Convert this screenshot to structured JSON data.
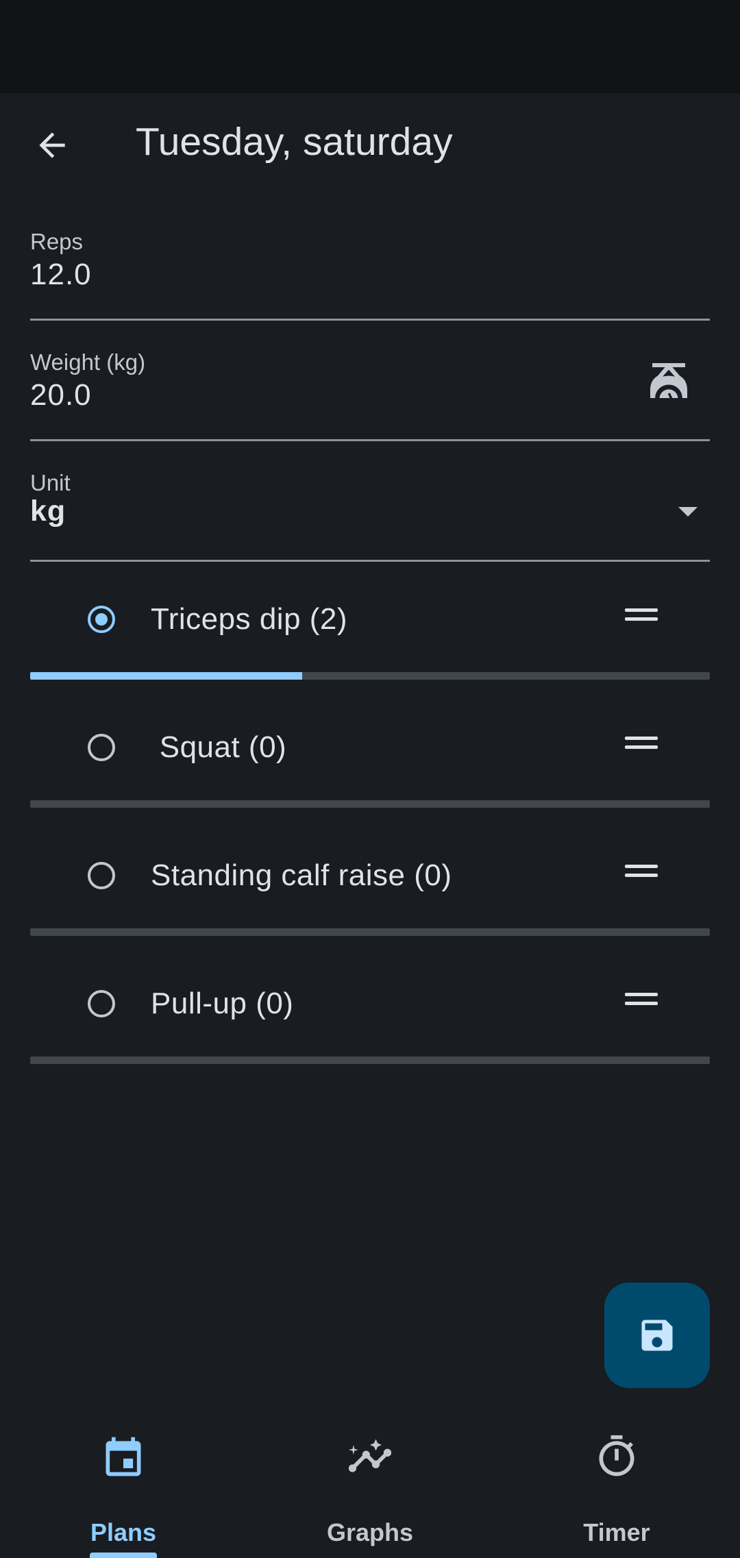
{
  "app_bar": {
    "title": "Tuesday, saturday"
  },
  "fields": {
    "reps": {
      "label": "Reps",
      "value": "12.0"
    },
    "weight": {
      "label": "Weight (kg)",
      "value": "20.0"
    },
    "unit": {
      "label": "Unit",
      "value": "kg"
    }
  },
  "exercises": [
    {
      "name": "Triceps dip (2)",
      "selected": true,
      "progress": 0.4
    },
    {
      "name": " Squat (0)",
      "selected": false,
      "progress": 0
    },
    {
      "name": "Standing calf raise (0)",
      "selected": false,
      "progress": 0
    },
    {
      "name": "Pull-up (0)",
      "selected": false,
      "progress": 0
    }
  ],
  "nav": {
    "items": [
      {
        "label": "Plans",
        "icon": "calendar-icon",
        "active": true
      },
      {
        "label": "Graphs",
        "icon": "insights-icon",
        "active": false
      },
      {
        "label": "Timer",
        "icon": "stopwatch-icon",
        "active": false
      }
    ]
  },
  "colors": {
    "accent": "#8ecdff",
    "fab_bg": "#004b6d",
    "background": "#191c20"
  }
}
